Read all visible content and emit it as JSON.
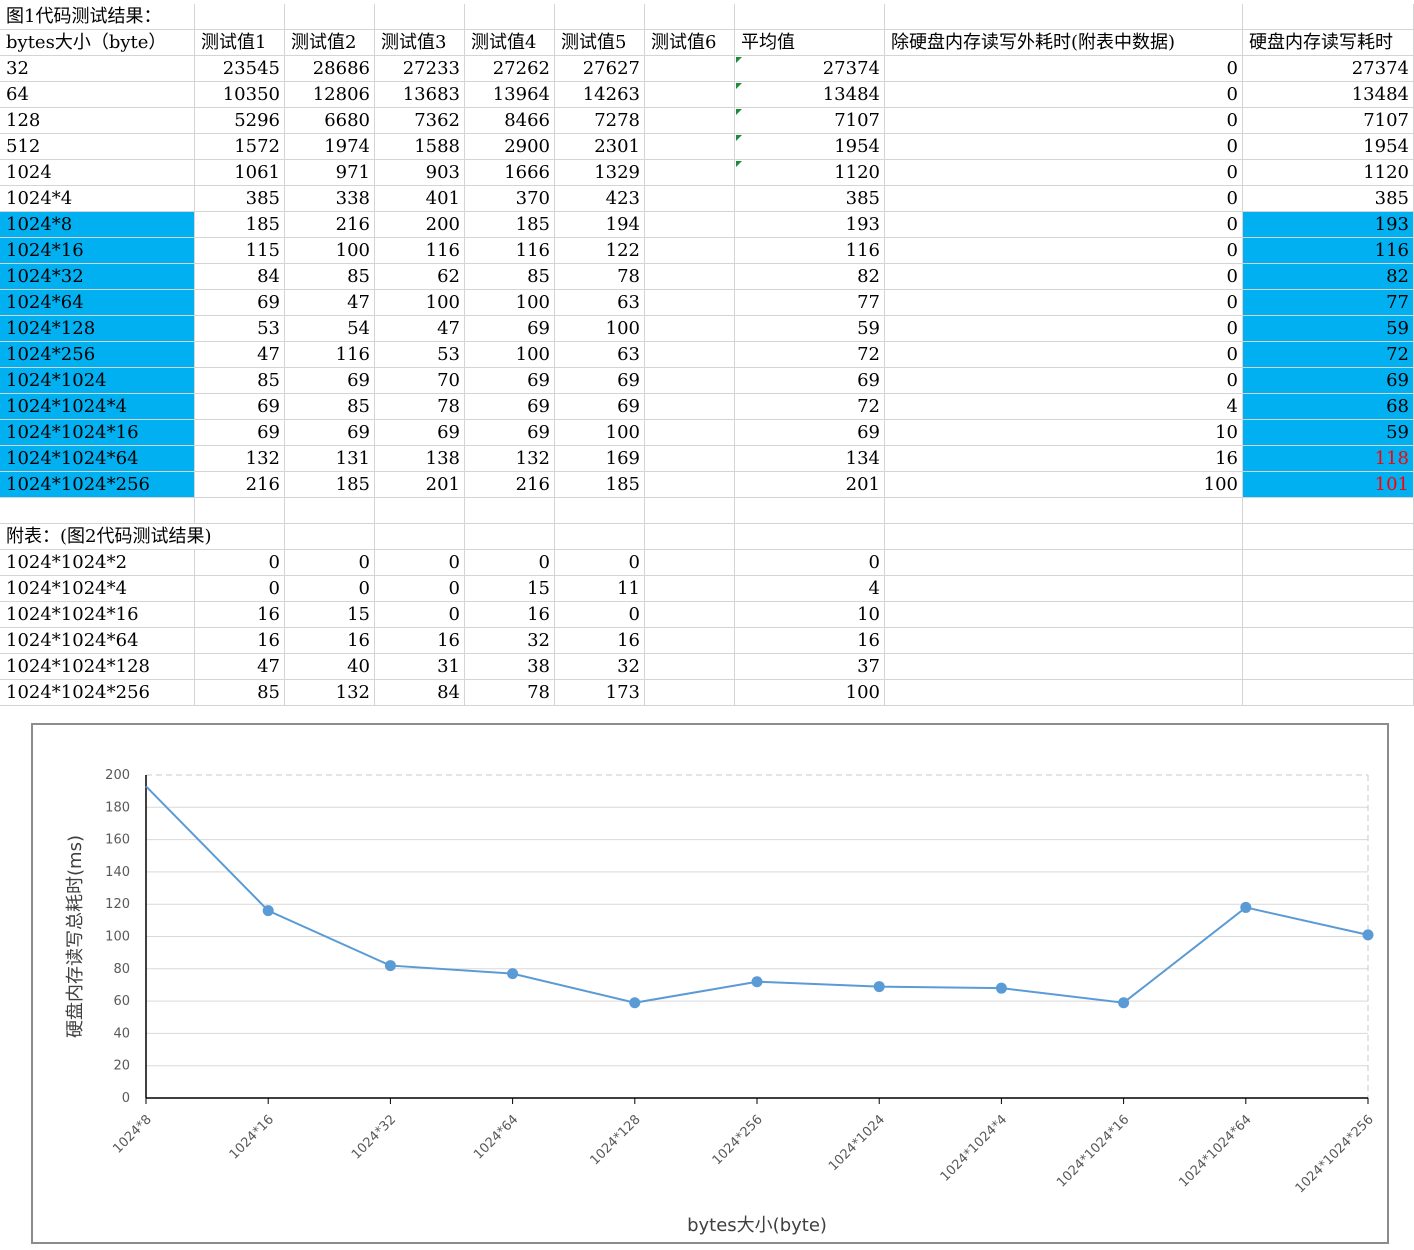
{
  "sheet": {
    "title1": "图1代码测试结果：",
    "headers": [
      "bytes大小（byte）",
      "测试值1",
      "测试值2",
      "测试值3",
      "测试值4",
      "测试值5",
      "测试值6",
      "平均值",
      "除硬盘内存读写外耗时(附表中数据)",
      "硬盘内存读写耗时"
    ],
    "rows": [
      {
        "label": "32",
        "v": [
          "23545",
          "28686",
          "27233",
          "27262",
          "27627"
        ],
        "avg": "27374",
        "other": "0",
        "disk": "27374"
      },
      {
        "label": "64",
        "v": [
          "10350",
          "12806",
          "13683",
          "13964",
          "14263"
        ],
        "avg": "13484",
        "other": "0",
        "disk": "13484"
      },
      {
        "label": "128",
        "v": [
          "5296",
          "6680",
          "7362",
          "8466",
          "7278"
        ],
        "avg": "7107",
        "other": "0",
        "disk": "7107"
      },
      {
        "label": "512",
        "v": [
          "1572",
          "1974",
          "1588",
          "2900",
          "2301"
        ],
        "avg": "1954",
        "other": "0",
        "disk": "1954"
      },
      {
        "label": "1024",
        "v": [
          "1061",
          "971",
          "903",
          "1666",
          "1329"
        ],
        "avg": "1120",
        "other": "0",
        "disk": "1120"
      },
      {
        "label": "1024*4",
        "v": [
          "385",
          "338",
          "401",
          "370",
          "423"
        ],
        "avg": "385",
        "other": "0",
        "disk": "385"
      },
      {
        "label": "1024*8",
        "v": [
          "185",
          "216",
          "200",
          "185",
          "194"
        ],
        "avg": "193",
        "other": "0",
        "disk": "193"
      },
      {
        "label": "1024*16",
        "v": [
          "115",
          "100",
          "116",
          "116",
          "122"
        ],
        "avg": "116",
        "other": "0",
        "disk": "116"
      },
      {
        "label": "1024*32",
        "v": [
          "84",
          "85",
          "62",
          "85",
          "78"
        ],
        "avg": "82",
        "other": "0",
        "disk": "82"
      },
      {
        "label": "1024*64",
        "v": [
          "69",
          "47",
          "100",
          "100",
          "63"
        ],
        "avg": "77",
        "other": "0",
        "disk": "77"
      },
      {
        "label": "1024*128",
        "v": [
          "53",
          "54",
          "47",
          "69",
          "100"
        ],
        "avg": "59",
        "other": "0",
        "disk": "59"
      },
      {
        "label": "1024*256",
        "v": [
          "47",
          "116",
          "53",
          "100",
          "63"
        ],
        "avg": "72",
        "other": "0",
        "disk": "72"
      },
      {
        "label": "1024*1024",
        "v": [
          "85",
          "69",
          "70",
          "69",
          "69"
        ],
        "avg": "69",
        "other": "0",
        "disk": "69"
      },
      {
        "label": "1024*1024*4",
        "v": [
          "69",
          "85",
          "78",
          "69",
          "69"
        ],
        "avg": "72",
        "other": "4",
        "disk": "68"
      },
      {
        "label": "1024*1024*16",
        "v": [
          "69",
          "69",
          "69",
          "69",
          "100"
        ],
        "avg": "69",
        "other": "10",
        "disk": "59"
      },
      {
        "label": "1024*1024*64",
        "v": [
          "132",
          "131",
          "138",
          "132",
          "169"
        ],
        "avg": "134",
        "other": "16",
        "disk": "118"
      },
      {
        "label": "1024*1024*256",
        "v": [
          "216",
          "185",
          "201",
          "216",
          "185"
        ],
        "avg": "201",
        "other": "100",
        "disk": "101"
      }
    ],
    "title2": "附表：(图2代码测试结果)",
    "appendix": [
      {
        "label": "1024*1024*2",
        "v": [
          "0",
          "0",
          "0",
          "0",
          "0"
        ],
        "avg": "0"
      },
      {
        "label": "1024*1024*4",
        "v": [
          "0",
          "0",
          "0",
          "15",
          "11"
        ],
        "avg": "4"
      },
      {
        "label": "1024*1024*16",
        "v": [
          "16",
          "15",
          "0",
          "16",
          "0"
        ],
        "avg": "10"
      },
      {
        "label": "1024*1024*64",
        "v": [
          "16",
          "16",
          "16",
          "32",
          "16"
        ],
        "avg": "16"
      },
      {
        "label": "1024*1024*128",
        "v": [
          "47",
          "40",
          "31",
          "38",
          "32"
        ],
        "avg": "37"
      },
      {
        "label": "1024*1024*256",
        "v": [
          "85",
          "132",
          "84",
          "78",
          "173"
        ],
        "avg": "100"
      }
    ],
    "colors": {
      "highlight": "#00b0f0",
      "red_text": "#ff0000",
      "grid": "#d4d4d4"
    }
  },
  "chart_data": {
    "type": "line",
    "categories": [
      "1024*8",
      "1024*16",
      "1024*32",
      "1024*64",
      "1024*128",
      "1024*256",
      "1024*1024",
      "1024*1024*4",
      "1024*1024*16",
      "1024*1024*64",
      "1024*1024*256"
    ],
    "series": [
      {
        "values": [
          193,
          116,
          82,
          77,
          59,
          72,
          69,
          68,
          59,
          118,
          101
        ]
      }
    ],
    "xlabel": "bytes大小(byte)",
    "ylabel": "硬盘内存读写总耗时(ms)",
    "ylim": [
      0,
      200
    ],
    "yticks": [
      0,
      20,
      40,
      60,
      80,
      100,
      120,
      140,
      160,
      180,
      200
    ],
    "grid": true,
    "color": "#5b9bd5"
  }
}
